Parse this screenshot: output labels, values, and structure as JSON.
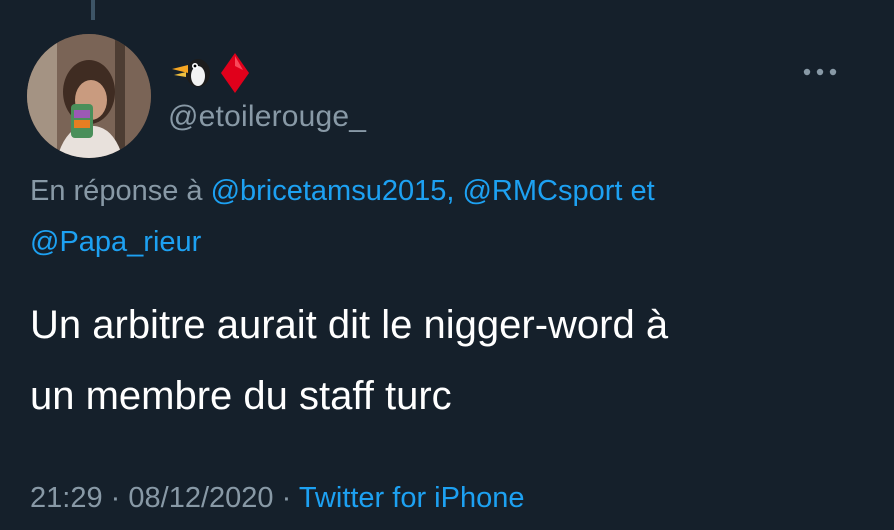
{
  "tweet": {
    "author": {
      "display_name_icons": [
        "penguin-emoji",
        "diamond-emoji"
      ],
      "handle": "@etoilerouge_"
    },
    "reply": {
      "prefix": "En réponse à",
      "mention_1": "@bricetamsu2015,",
      "mention_2": "@RMCsport",
      "joiner": "et",
      "mention_3": "@Papa_rieur"
    },
    "text_line_1": "Un arbitre aurait dit le nigger-word à",
    "text_line_2": "un membre du staff turc",
    "time": "21:29",
    "separator": "·",
    "date": "08/12/2020",
    "source": "Twitter for iPhone"
  },
  "colors": {
    "background": "#15202b",
    "secondary_text": "#8899a6",
    "link": "#1da1f2",
    "diamond": "#e0001b"
  }
}
